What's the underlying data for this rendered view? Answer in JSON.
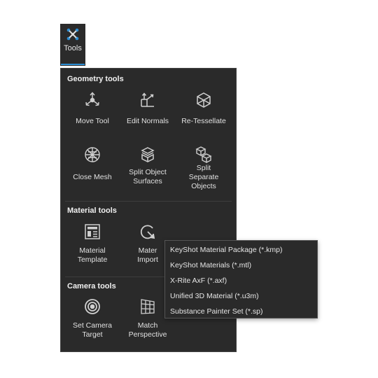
{
  "toolbar": {
    "tools_label": "Tools"
  },
  "geometry": {
    "title": "Geometry tools",
    "tools": [
      {
        "label": "Move Tool",
        "icon": "move-tool-icon"
      },
      {
        "label": "Edit Normals",
        "icon": "edit-normals-icon"
      },
      {
        "label": "Re-Tessellate",
        "icon": "re-tessellate-icon"
      },
      {
        "label": "Close Mesh",
        "icon": "close-mesh-icon"
      },
      {
        "label": "Split Object\nSurfaces",
        "icon": "split-object-surfaces-icon"
      },
      {
        "label": "Split\nSeparate\nObjects",
        "icon": "split-separate-objects-icon"
      }
    ]
  },
  "material": {
    "title": "Material tools",
    "tools": [
      {
        "label": "Material\nTemplate",
        "icon": "material-template-icon"
      },
      {
        "label": "Mater\nImport",
        "icon": "material-import-icon"
      }
    ]
  },
  "camera": {
    "title": "Camera tools",
    "tools": [
      {
        "label": "Set Camera\nTarget",
        "icon": "set-camera-target-icon"
      },
      {
        "label": "Match\nPerspective",
        "icon": "match-perspective-icon"
      }
    ]
  },
  "import_menu": {
    "items": [
      "KeyShot Material Package (*.kmp)",
      "KeyShot Materials (*.mtl)",
      "X-Rite AxF (*.axf)",
      "Unified 3D Material (*.u3m)",
      "Substance Painter Set (*.sp)"
    ]
  },
  "colors": {
    "panel_bg": "#2a2a2a",
    "accent": "#2d8fd5",
    "text": "#e6e6e6"
  }
}
